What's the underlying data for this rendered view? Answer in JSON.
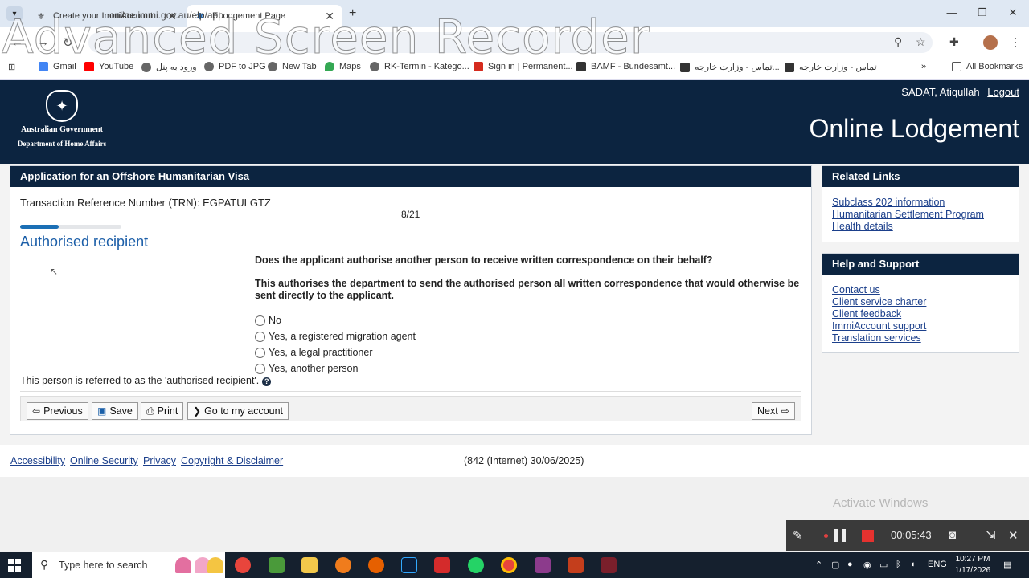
{
  "browser": {
    "tabs": [
      {
        "label": "Create your ImmiAccount",
        "active": false
      },
      {
        "label": "ELodgement Page",
        "active": true
      }
    ],
    "url": "online.immi.gov.au/elp/app",
    "bookmarks": [
      {
        "label": "Gmail",
        "color": "#4285f4"
      },
      {
        "label": "YouTube",
        "color": "#ff0000"
      },
      {
        "label": "ورود به پنل",
        "color": "#555555"
      },
      {
        "label": "PDF to JPG",
        "color": "#555555"
      },
      {
        "label": "New Tab",
        "color": "#555555"
      },
      {
        "label": "Maps",
        "color": "#34a853"
      },
      {
        "label": "RK-Termin - Katego...",
        "color": "#555555"
      },
      {
        "label": "Sign in | Permanent...",
        "color": "#d52b1e"
      },
      {
        "label": "BAMF - Bundesamt...",
        "color": "#333333"
      },
      {
        "label": "تماس - وزارت خارجه...",
        "color": "#333333"
      },
      {
        "label": "تماس - وزارت خارجه",
        "color": "#333333"
      }
    ],
    "all_bookmarks": "All Bookmarks"
  },
  "watermark": "Advanced Screen Recorder",
  "header": {
    "govt": "Australian Government",
    "dept": "Department of Home Affairs",
    "user": "SADAT, Atiqullah",
    "logout": "Logout",
    "title": "Online Lodgement"
  },
  "main": {
    "panel_title": "Application for an Offshore Humanitarian Visa",
    "trn": "Transaction Reference Number (TRN): EGPATULGTZ",
    "progress_label": "8/21",
    "progress_fraction": 0.38,
    "section_title": "Authorised recipient",
    "question": "Does the applicant authorise another person to receive written correspondence on their behalf?",
    "explanation": "This authorises the department to send the authorised person all written correspondence that would otherwise be sent directly to the applicant.",
    "options": [
      "No",
      "Yes, a registered migration agent",
      "Yes, a legal practitioner",
      "Yes, another person"
    ],
    "referred": "This person is referred to as the 'authorised recipient'.",
    "buttons": {
      "previous": "Previous",
      "save": "Save",
      "print": "Print",
      "account": "Go to my account",
      "next": "Next"
    }
  },
  "related": {
    "title": "Related Links",
    "links": [
      "Subclass 202 information",
      "Humanitarian Settlement Program",
      "Health details"
    ]
  },
  "help": {
    "title": "Help and Support",
    "links": [
      "Contact us",
      "Client service charter",
      "Client feedback",
      "ImmiAccount support",
      "Translation services"
    ]
  },
  "footer": {
    "links": [
      "Accessibility",
      "Online Security",
      "Privacy",
      "Copyright & Disclaimer"
    ],
    "version": "(842 (Internet) 30/06/2025)"
  },
  "activate_windows": "Activate Windows",
  "recorder": {
    "time": "00:05:43"
  },
  "taskbar": {
    "search_placeholder": "Type here to search",
    "lang": "ENG",
    "time": "10:27 PM",
    "date": "1/17/2026"
  }
}
